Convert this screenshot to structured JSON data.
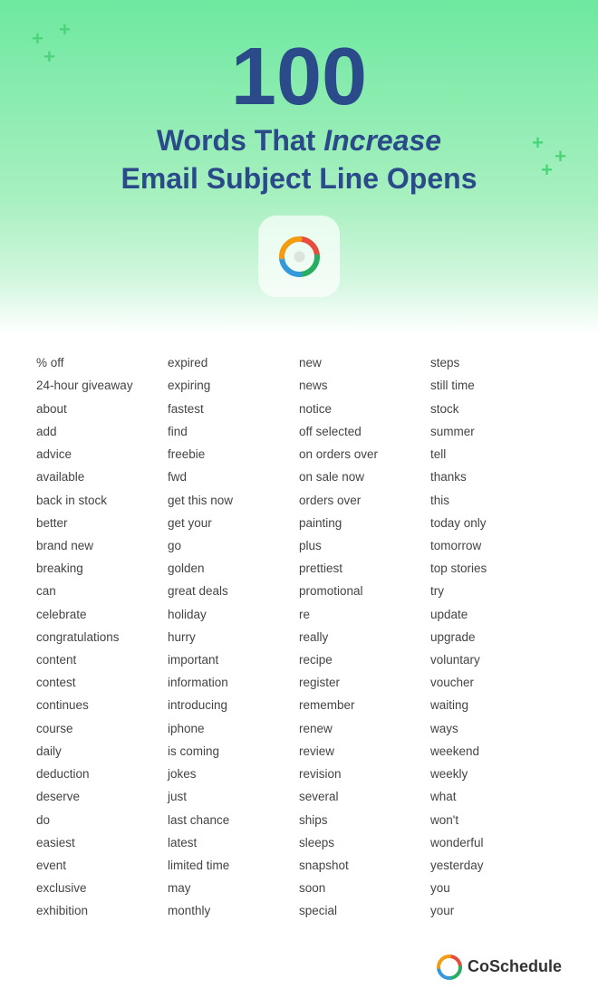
{
  "header": {
    "number": "100",
    "subtitle_line1": "Words That ",
    "subtitle_italic": "Increase",
    "subtitle_line2": "Email Subject Line Opens"
  },
  "footer": {
    "brand": "CoSchedule"
  },
  "columns": [
    {
      "id": "col1",
      "words": [
        "% off",
        "24-hour giveaway",
        "about",
        "add",
        "advice",
        "available",
        "back in stock",
        "better",
        "brand new",
        "breaking",
        "can",
        "celebrate",
        "congratulations",
        "content",
        "contest",
        "continues",
        "course",
        "daily",
        "deduction",
        "deserve",
        "do",
        "easiest",
        "event",
        "exclusive",
        "exhibition"
      ]
    },
    {
      "id": "col2",
      "words": [
        "expired",
        "expiring",
        "fastest",
        "find",
        "freebie",
        "fwd",
        "get this now",
        "get your",
        "go",
        "golden",
        "great deals",
        "holiday",
        "hurry",
        "important",
        "information",
        "introducing",
        "iphone",
        "is coming",
        "jokes",
        "just",
        "last chance",
        "latest",
        "limited time",
        "may",
        "monthly"
      ]
    },
    {
      "id": "col3",
      "words": [
        "new",
        "news",
        "notice",
        "off selected",
        "on orders over",
        "on sale now",
        "orders over",
        "painting",
        "plus",
        "prettiest",
        "promotional",
        "re",
        "really",
        "recipe",
        "register",
        "remember",
        "renew",
        "review",
        "revision",
        "several",
        "ships",
        "sleeps",
        "snapshot",
        "soon",
        "special"
      ]
    },
    {
      "id": "col4",
      "words": [
        "steps",
        "still time",
        "stock",
        "summer",
        "tell",
        "thanks",
        "this",
        "today only",
        "tomorrow",
        "top stories",
        "try",
        "update",
        "upgrade",
        "voluntary",
        "voucher",
        "waiting",
        "ways",
        "weekend",
        "weekly",
        "what",
        "won't",
        "wonderful",
        "yesterday",
        "you",
        "your"
      ]
    }
  ]
}
